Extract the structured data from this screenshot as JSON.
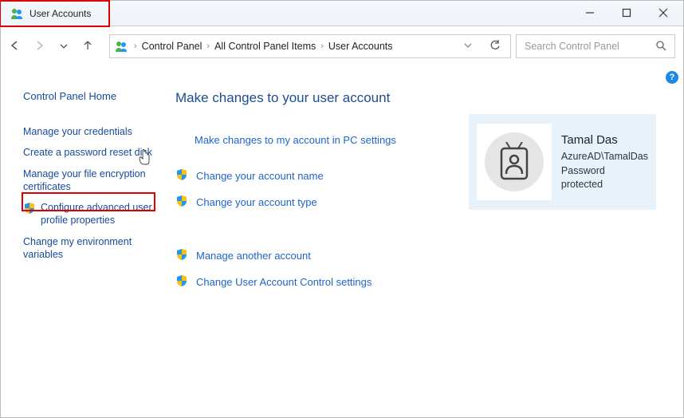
{
  "titlebar": {
    "title": "User Accounts"
  },
  "breadcrumb": {
    "parts": [
      "Control Panel",
      "All Control Panel Items",
      "User Accounts"
    ]
  },
  "search": {
    "placeholder": "Search Control Panel"
  },
  "sidebar": {
    "home": "Control Panel Home",
    "links": {
      "manage_credentials": "Manage your credentials",
      "reset_disk": "Create a password reset disk",
      "file_encryption": "Manage your file encryption certificates",
      "advanced_profile": "Configure advanced user profile properties",
      "env_vars": "Change my environment variables"
    }
  },
  "main": {
    "heading": "Make changes to your user account",
    "pc_settings_link": "Make changes to my account in PC settings",
    "change_name": "Change your account name",
    "change_type": "Change your account type",
    "manage_another": "Manage another account",
    "uac_settings": "Change User Account Control settings"
  },
  "user": {
    "name": "Tamal Das",
    "domain": "AzureAD\\TamalDas",
    "status": "Password protected"
  }
}
